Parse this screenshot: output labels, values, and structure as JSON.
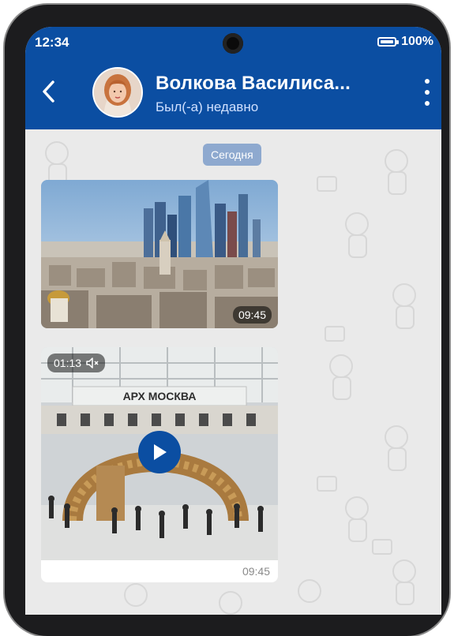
{
  "status_bar": {
    "time": "12:34",
    "battery": "100%"
  },
  "chat_header": {
    "title": "Волкова Василиса...",
    "subtitle": "Был(-а) недавно",
    "back_icon": "chevron-left-icon",
    "menu_icon": "more-vertical-icon"
  },
  "date_separator": "Сегодня",
  "messages": [
    {
      "type": "image",
      "time": "09:45"
    },
    {
      "type": "video",
      "duration": "01:13",
      "time": "09:45",
      "sign_text": "АРХ МОСКВА"
    }
  ],
  "colors": {
    "accent": "#0b4ea2",
    "background": "#eaeaea"
  }
}
